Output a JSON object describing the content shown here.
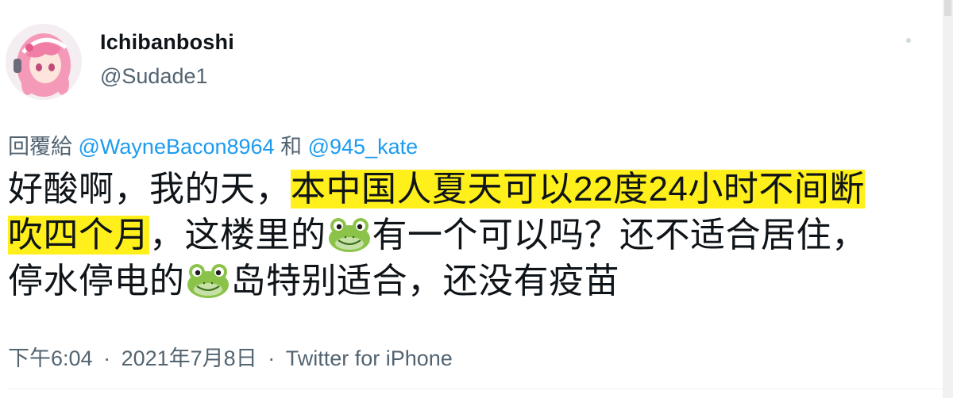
{
  "author": {
    "display_name": "Ichibanboshi",
    "handle": "@Sudade1",
    "avatar_icon": "anime-avatar-icon"
  },
  "reply": {
    "prefix": "回覆給",
    "mention_1": "@WayneBacon8964",
    "conjunction": "和",
    "mention_2": "@945_kate"
  },
  "tweet": {
    "line1_plain": "好酸啊，我的天，",
    "line1_highlight": "本中国人夏天可以22度24小时不间断",
    "line2_highlight": "吹四个月",
    "line2_plain_a": "，这楼里的",
    "line2_plain_b": "有一个可以吗？还不适合居住，",
    "line3_plain_a": "停水停电的",
    "line3_plain_b": "岛特别适合，还没有疫苗",
    "emoji_name": "frog-face-icon",
    "highlight_color": "#ffef1a"
  },
  "meta": {
    "time": "下午6:04",
    "separator_1": "·",
    "date": "2021年7月8日",
    "separator_2": "·",
    "source": "Twitter for iPhone"
  },
  "colors": {
    "text": "#0f1419",
    "secondary": "#536471",
    "link": "#1d9bf0"
  }
}
